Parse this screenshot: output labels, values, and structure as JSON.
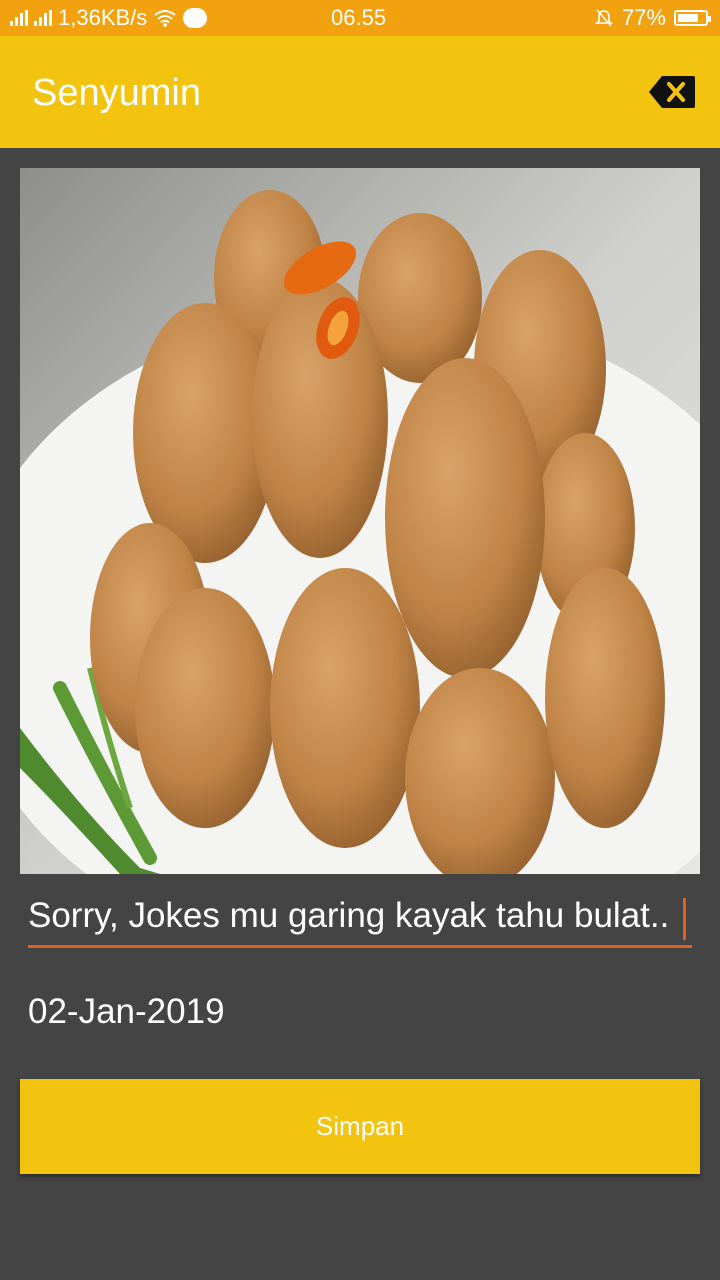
{
  "status_bar": {
    "network_speed": "1,36KB/s",
    "time": "06.55",
    "battery_percent": "77%",
    "battery_level": 0.77,
    "icons": [
      "signal-icon",
      "wifi-icon",
      "chat-notification-icon",
      "mute-bell-icon",
      "battery-icon"
    ]
  },
  "app_bar": {
    "title": "Senyumin",
    "action_icon": "delete-backspace-icon"
  },
  "content": {
    "caption": "Sorry, Jokes mu garing kayak tahu bulat..",
    "date": "02-Jan-2019",
    "save_label": "Simpan"
  },
  "colors": {
    "status_bar": "#F2A20F",
    "accent": "#F2C30F",
    "background": "#444444",
    "underline": "#E0631A"
  }
}
